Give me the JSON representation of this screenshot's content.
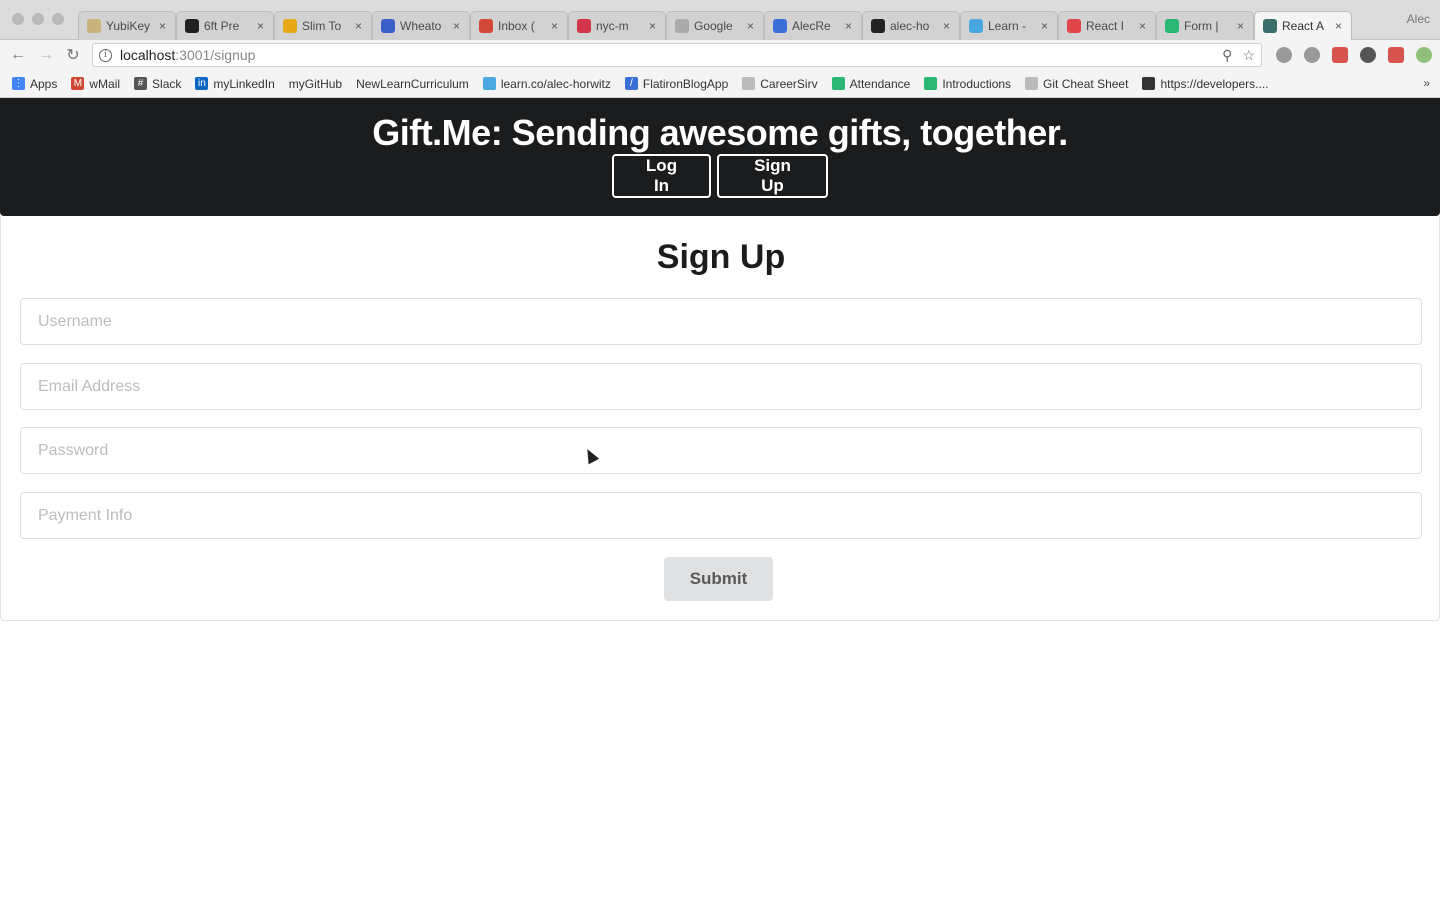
{
  "browser": {
    "tabs": [
      {
        "label": "YubiKey",
        "color": "#c9b37a"
      },
      {
        "label": "6ft Pre",
        "color": "#222222"
      },
      {
        "label": "Slim To",
        "color": "#e6a817"
      },
      {
        "label": "Wheato",
        "color": "#3b5fc9"
      },
      {
        "label": "Inbox (",
        "color": "#d14836"
      },
      {
        "label": "nyc-m",
        "color": "#d1364b"
      },
      {
        "label": "Google",
        "color": "#aaaaaa"
      },
      {
        "label": "AlecRe",
        "color": "#3b6fd6"
      },
      {
        "label": "alec-ho",
        "color": "#222222"
      },
      {
        "label": "Learn -",
        "color": "#49a8e0"
      },
      {
        "label": "React I",
        "color": "#e0444b"
      },
      {
        "label": "Form |",
        "color": "#2bb673"
      },
      {
        "label": "React A",
        "color": "#3a6e6b",
        "active": true
      }
    ],
    "profile_name": "Alec",
    "url_host": "localhost",
    "url_rest": ":3001/signup",
    "bookmarks": [
      {
        "label": "Apps",
        "color": "#4285f4",
        "glyph": "⋮"
      },
      {
        "label": "wMail",
        "color": "#d14836",
        "glyph": "M"
      },
      {
        "label": "Slack",
        "color": "#555555",
        "glyph": "#"
      },
      {
        "label": "myLinkedIn",
        "color": "#0a66c2",
        "glyph": "in"
      },
      {
        "label": "myGitHub",
        "color": "",
        "glyph": ""
      },
      {
        "label": "NewLearnCurriculum",
        "color": "",
        "glyph": ""
      },
      {
        "label": "learn.co/alec-horwitz",
        "color": "#49a8e0",
        "glyph": ""
      },
      {
        "label": "FlatironBlogApp",
        "color": "#3b6fd6",
        "glyph": "/"
      },
      {
        "label": "CareerSirv",
        "color": "#bbbbbb",
        "glyph": ""
      },
      {
        "label": "Attendance",
        "color": "#2bb673",
        "glyph": ""
      },
      {
        "label": "Introductions",
        "color": "#2bb673",
        "glyph": ""
      },
      {
        "label": "Git Cheat Sheet",
        "color": "#bbbbbb",
        "glyph": ""
      },
      {
        "label": "https://developers....",
        "color": "#333333",
        "glyph": ""
      }
    ],
    "bookmarks_more": "»"
  },
  "header": {
    "title": "Gift.Me: Sending awesome gifts, together.",
    "login_label": "Log In",
    "signup_label": "Sign Up"
  },
  "form": {
    "title": "Sign Up",
    "username_placeholder": "Username",
    "email_placeholder": "Email Address",
    "password_placeholder": "Password",
    "payment_placeholder": "Payment Info",
    "submit_label": "Submit"
  }
}
